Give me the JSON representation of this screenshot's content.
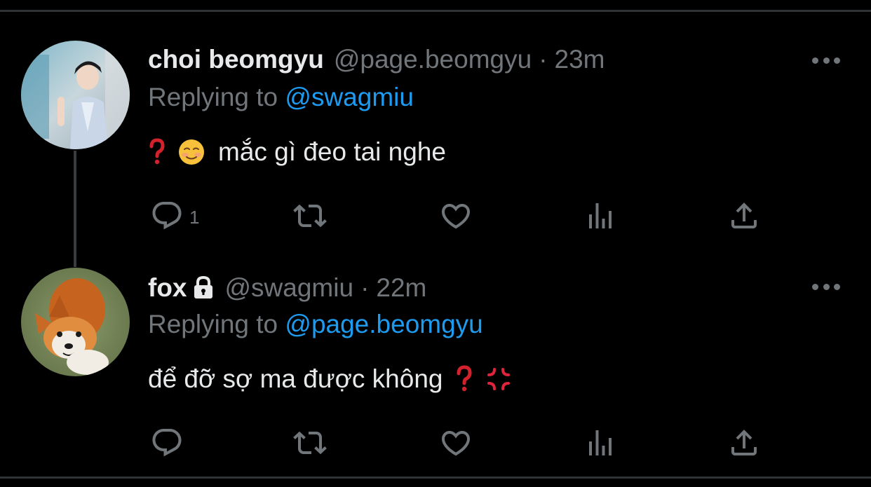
{
  "tweets": [
    {
      "name": "choi beomgyu",
      "handle": "@page.beomgyu",
      "separator": "·",
      "time": "23m",
      "replying_prefix": "Replying to",
      "replying_to": "@swagmiu",
      "text": "mắc gì đeo tai nghe",
      "emoji_before": [
        "question-mark",
        "smiling-face"
      ],
      "emoji_after": [],
      "reply_count": "1",
      "protected": false
    },
    {
      "name": "fox",
      "handle": "@swagmiu",
      "separator": "·",
      "time": "22m",
      "replying_prefix": "Replying to",
      "replying_to": "@page.beomgyu",
      "text": "để đỡ sợ ma được không",
      "emoji_before": [],
      "emoji_after": [
        "question-mark",
        "anger-symbol"
      ],
      "reply_count": "",
      "protected": true
    }
  ],
  "colors": {
    "background": "#000000",
    "text": "#e7e9ea",
    "secondary": "#71767b",
    "link": "#1d9bf0",
    "divider": "#2f3336"
  },
  "icons": [
    "more-icon",
    "reply-icon",
    "retweet-icon",
    "like-icon",
    "views-icon",
    "share-icon",
    "lock-icon"
  ]
}
